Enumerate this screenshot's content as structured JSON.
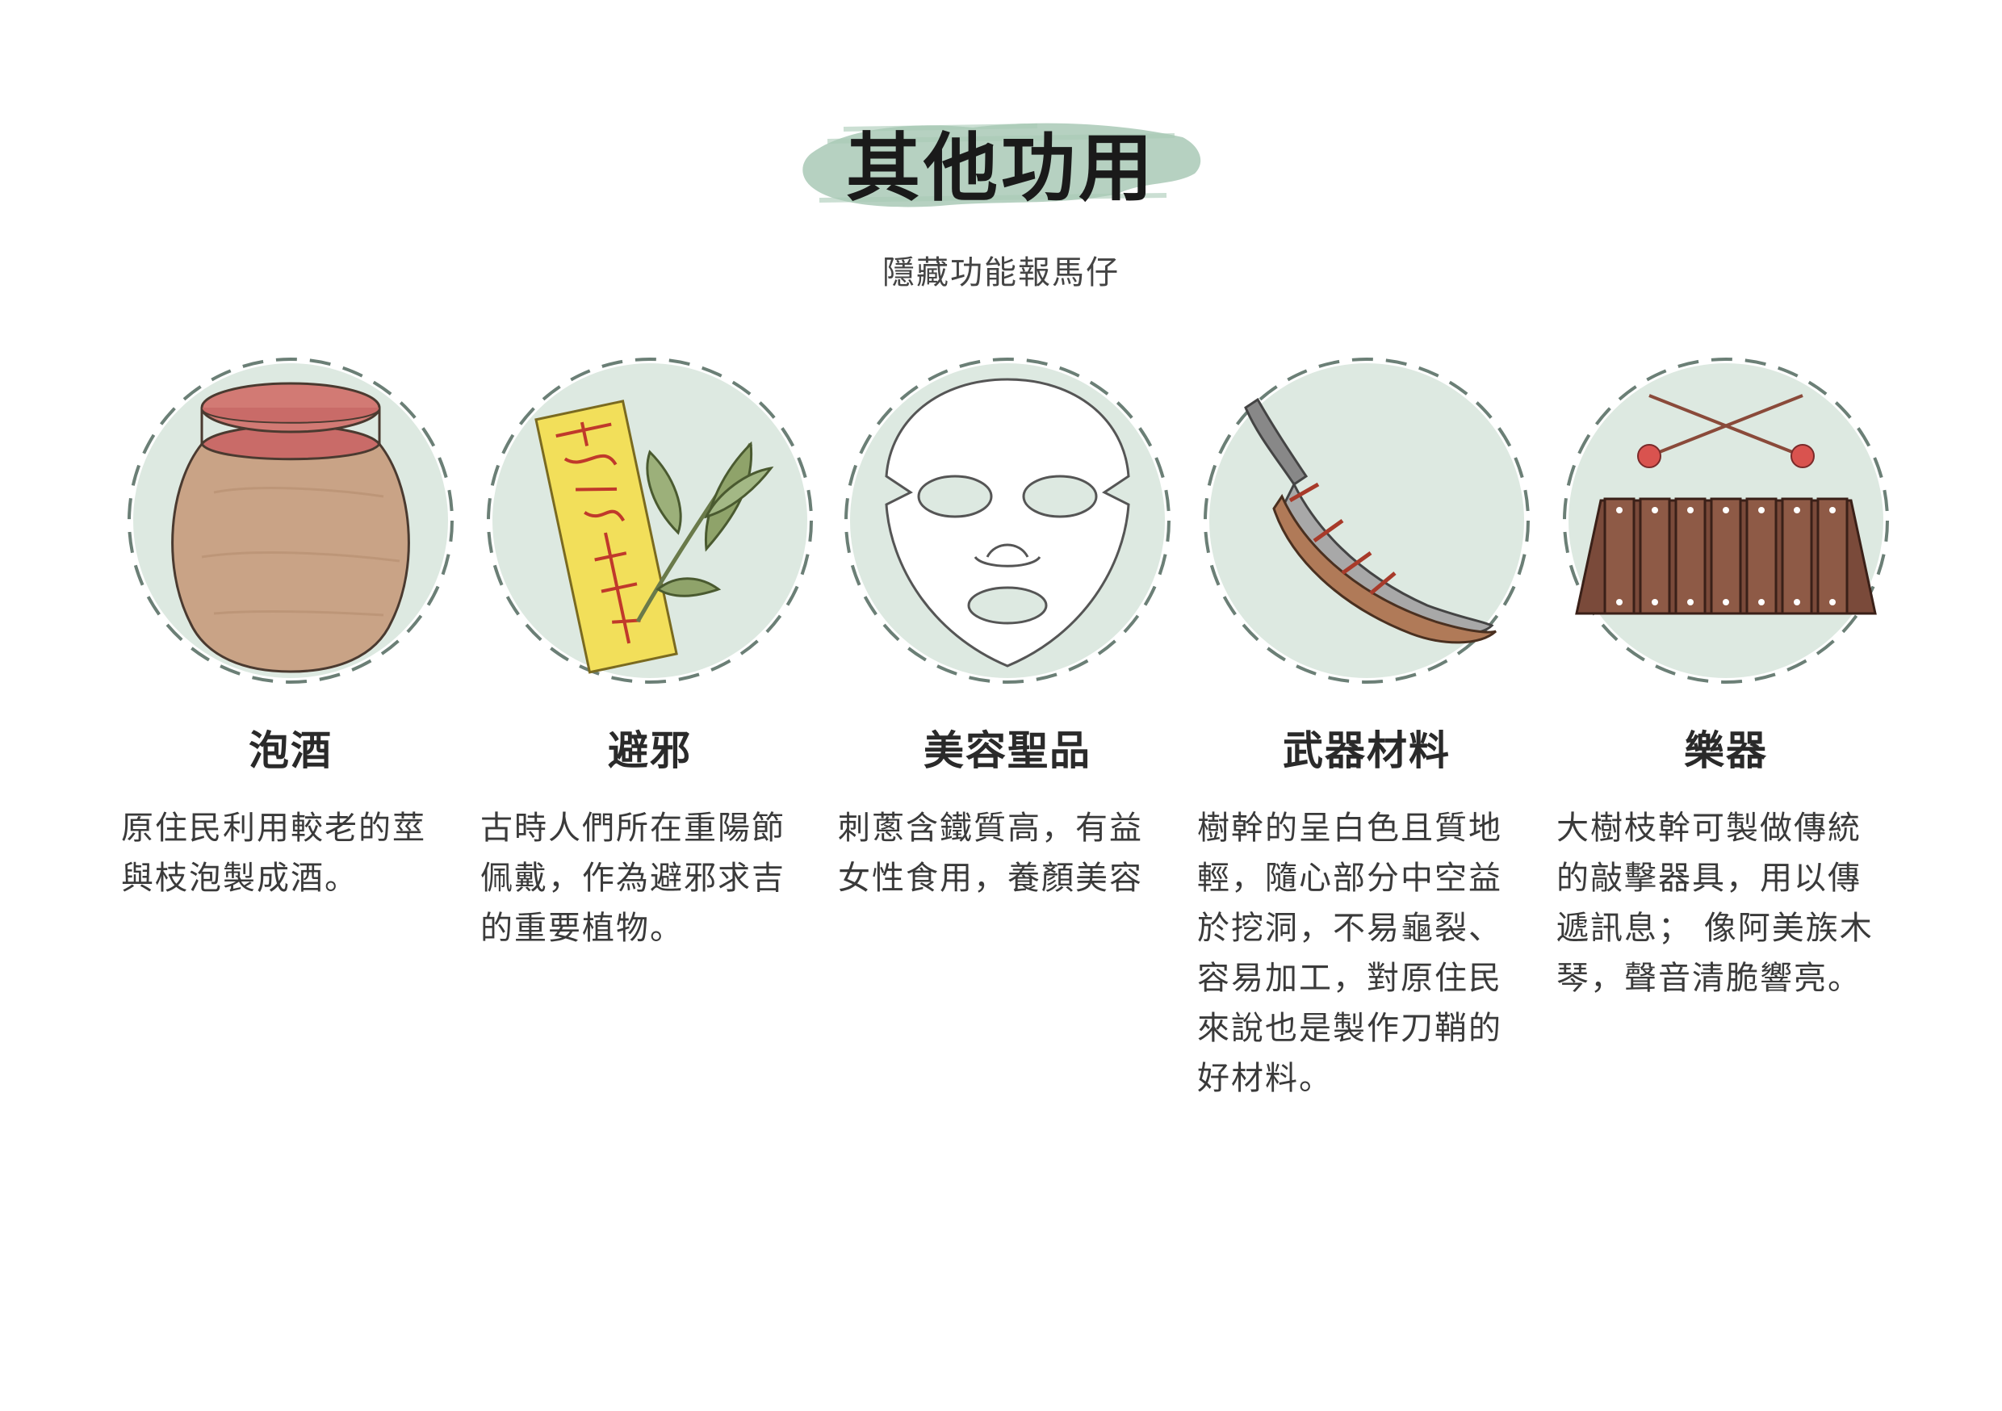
{
  "header": {
    "title": "其他功用",
    "subtitle": "隱藏功能報馬仔"
  },
  "colors": {
    "circle_fill": "#dde9e1",
    "dash": "#6b7f76",
    "brush": "#a9c9b6"
  },
  "cards": [
    {
      "icon": "wine-jar-icon",
      "name": "泡酒",
      "desc": "原住民利用較老的莖\n與枝泡製成酒。"
    },
    {
      "icon": "talisman-leaf-icon",
      "name": "避邪",
      "desc": "古時人們所在重陽節\n佩戴，作為避邪求吉\n的重要植物。"
    },
    {
      "icon": "face-mask-icon",
      "name": "美容聖品",
      "desc": "刺蔥含鐵質高，有益\n女性食用，養顏美容"
    },
    {
      "icon": "knife-sheath-icon",
      "name": "武器材料",
      "desc": "樹幹的呈白色且質地\n輕，隨心部分中空益\n於挖洞，不易龜裂、\n容易加工，對原住民\n來說也是製作刀鞘的\n好材料。"
    },
    {
      "icon": "xylophone-icon",
      "name": "樂器",
      "desc": "大樹枝幹可製做傳統\n的敲擊器具，用以傳\n遞訊息；   像阿美族木\n琴，聲音清脆響亮。"
    }
  ]
}
